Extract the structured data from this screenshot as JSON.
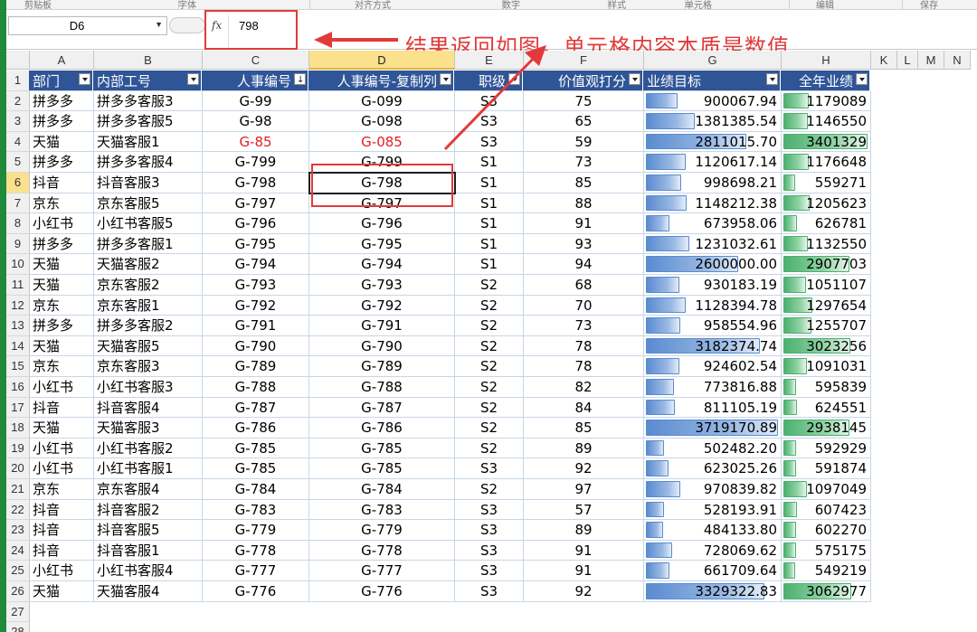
{
  "ribbon": {
    "groups": [
      "剪贴板",
      "字体",
      "对齐方式",
      "数字",
      "样式",
      "单元格",
      "编辑",
      "保存"
    ]
  },
  "formula_bar": {
    "name_box": "D6",
    "fx_label": "fx",
    "value": "798"
  },
  "annotation": {
    "text": "结果返回如图，单元格内容本质是数值"
  },
  "sheet": {
    "columns": [
      "A",
      "B",
      "C",
      "D",
      "E",
      "F",
      "G",
      "H",
      "K",
      "L",
      "M",
      "N"
    ],
    "active_column": "D",
    "active_row": "6",
    "headers": [
      "部门",
      "内部工号",
      "人事编号",
      "人事编号-复制列",
      "职级",
      "价值观打分",
      "业绩目标",
      "全年业绩"
    ],
    "rows": [
      {
        "n": "2",
        "dept": "拼多多",
        "staff": "拼多多客服3",
        "id": "G-99",
        "id_copy": "G-099",
        "level": "S3",
        "score": "75",
        "target": "900067.94",
        "target_frac": 0.24,
        "actual": "1179089",
        "actual_frac": 0.3
      },
      {
        "n": "3",
        "dept": "拼多多",
        "staff": "拼多多客服5",
        "id": "G-98",
        "id_copy": "G-098",
        "level": "S3",
        "score": "65",
        "target": "1381385.54",
        "target_frac": 0.37,
        "actual": "1146550",
        "actual_frac": 0.29
      },
      {
        "n": "4",
        "dept": "天猫",
        "staff": "天猫客服1",
        "id": "G-85",
        "id_copy": "G-085",
        "level": "S3",
        "score": "59",
        "target": "2811015.70",
        "target_frac": 0.76,
        "actual": "3401329",
        "actual_frac": 1.0,
        "red": true
      },
      {
        "n": "5",
        "dept": "拼多多",
        "staff": "拼多多客服4",
        "id": "G-799",
        "id_copy": "G-799",
        "level": "S1",
        "score": "73",
        "target": "1120617.14",
        "target_frac": 0.3,
        "actual": "1176648",
        "actual_frac": 0.3
      },
      {
        "n": "6",
        "dept": "抖音",
        "staff": "抖音客服3",
        "id": "G-798",
        "id_copy": "G-798",
        "level": "S1",
        "score": "85",
        "target": "998698.21",
        "target_frac": 0.27,
        "actual": "559271",
        "actual_frac": 0.14
      },
      {
        "n": "7",
        "dept": "京东",
        "staff": "京东客服5",
        "id": "G-797",
        "id_copy": "G-797",
        "level": "S1",
        "score": "88",
        "target": "1148212.38",
        "target_frac": 0.31,
        "actual": "1205623",
        "actual_frac": 0.31
      },
      {
        "n": "8",
        "dept": "小红书",
        "staff": "小红书客服5",
        "id": "G-796",
        "id_copy": "G-796",
        "level": "S1",
        "score": "91",
        "target": "673958.06",
        "target_frac": 0.18,
        "actual": "626781",
        "actual_frac": 0.16
      },
      {
        "n": "9",
        "dept": "拼多多",
        "staff": "拼多多客服1",
        "id": "G-795",
        "id_copy": "G-795",
        "level": "S1",
        "score": "93",
        "target": "1231032.61",
        "target_frac": 0.33,
        "actual": "1132550",
        "actual_frac": 0.29
      },
      {
        "n": "10",
        "dept": "天猫",
        "staff": "天猫客服2",
        "id": "G-794",
        "id_copy": "G-794",
        "level": "S1",
        "score": "94",
        "target": "2600000.00",
        "target_frac": 0.7,
        "actual": "2907703",
        "actual_frac": 0.78
      },
      {
        "n": "11",
        "dept": "天猫",
        "staff": "京东客服2",
        "id": "G-793",
        "id_copy": "G-793",
        "level": "S2",
        "score": "68",
        "target": "930183.19",
        "target_frac": 0.25,
        "actual": "1051107",
        "actual_frac": 0.27
      },
      {
        "n": "12",
        "dept": "京东",
        "staff": "京东客服1",
        "id": "G-792",
        "id_copy": "G-792",
        "level": "S2",
        "score": "70",
        "target": "1128394.78",
        "target_frac": 0.3,
        "actual": "1297654",
        "actual_frac": 0.34
      },
      {
        "n": "13",
        "dept": "拼多多",
        "staff": "拼多多客服2",
        "id": "G-791",
        "id_copy": "G-791",
        "level": "S2",
        "score": "73",
        "target": "958554.96",
        "target_frac": 0.26,
        "actual": "1255707",
        "actual_frac": 0.33
      },
      {
        "n": "14",
        "dept": "天猫",
        "staff": "天猫客服5",
        "id": "G-790",
        "id_copy": "G-790",
        "level": "S2",
        "score": "78",
        "target": "3182374.74",
        "target_frac": 0.86,
        "actual": "3023256",
        "actual_frac": 0.8
      },
      {
        "n": "15",
        "dept": "京东",
        "staff": "京东客服3",
        "id": "G-789",
        "id_copy": "G-789",
        "level": "S2",
        "score": "78",
        "target": "924602.54",
        "target_frac": 0.25,
        "actual": "1091031",
        "actual_frac": 0.28
      },
      {
        "n": "16",
        "dept": "小红书",
        "staff": "小红书客服3",
        "id": "G-788",
        "id_copy": "G-788",
        "level": "S2",
        "score": "82",
        "target": "773816.88",
        "target_frac": 0.21,
        "actual": "595839",
        "actual_frac": 0.15
      },
      {
        "n": "17",
        "dept": "抖音",
        "staff": "抖音客服4",
        "id": "G-787",
        "id_copy": "G-787",
        "level": "S2",
        "score": "84",
        "target": "811105.19",
        "target_frac": 0.22,
        "actual": "624551",
        "actual_frac": 0.16
      },
      {
        "n": "18",
        "dept": "天猫",
        "staff": "天猫客服3",
        "id": "G-786",
        "id_copy": "G-786",
        "level": "S2",
        "score": "85",
        "target": "3719170.89",
        "target_frac": 1.0,
        "actual": "2938145",
        "actual_frac": 0.78
      },
      {
        "n": "19",
        "dept": "小红书",
        "staff": "小红书客服2",
        "id": "G-785",
        "id_copy": "G-785",
        "level": "S2",
        "score": "89",
        "target": "502482.20",
        "target_frac": 0.14,
        "actual": "592929",
        "actual_frac": 0.15
      },
      {
        "n": "20",
        "dept": "小红书",
        "staff": "小红书客服1",
        "id": "G-785",
        "id_copy": "G-785",
        "level": "S3",
        "score": "92",
        "target": "623025.26",
        "target_frac": 0.17,
        "actual": "591874",
        "actual_frac": 0.15
      },
      {
        "n": "21",
        "dept": "京东",
        "staff": "京东客服4",
        "id": "G-784",
        "id_copy": "G-784",
        "level": "S2",
        "score": "97",
        "target": "970839.82",
        "target_frac": 0.26,
        "actual": "1097049",
        "actual_frac": 0.28
      },
      {
        "n": "22",
        "dept": "抖音",
        "staff": "抖音客服2",
        "id": "G-783",
        "id_copy": "G-783",
        "level": "S3",
        "score": "57",
        "target": "528193.91",
        "target_frac": 0.14,
        "actual": "607423",
        "actual_frac": 0.16
      },
      {
        "n": "23",
        "dept": "抖音",
        "staff": "抖音客服5",
        "id": "G-779",
        "id_copy": "G-779",
        "level": "S3",
        "score": "89",
        "target": "484133.80",
        "target_frac": 0.13,
        "actual": "602270",
        "actual_frac": 0.15
      },
      {
        "n": "24",
        "dept": "抖音",
        "staff": "抖音客服1",
        "id": "G-778",
        "id_copy": "G-778",
        "level": "S3",
        "score": "91",
        "target": "728069.62",
        "target_frac": 0.2,
        "actual": "575175",
        "actual_frac": 0.15
      },
      {
        "n": "25",
        "dept": "小红书",
        "staff": "小红书客服4",
        "id": "G-777",
        "id_copy": "G-777",
        "level": "S3",
        "score": "91",
        "target": "661709.64",
        "target_frac": 0.18,
        "actual": "549219",
        "actual_frac": 0.14
      },
      {
        "n": "26",
        "dept": "天猫",
        "staff": "天猫客服4",
        "id": "G-776",
        "id_copy": "G-776",
        "level": "S3",
        "score": "92",
        "target": "3329322.83",
        "target_frac": 0.9,
        "actual": "3062977",
        "actual_frac": 0.81
      }
    ],
    "extra_rows": [
      "27",
      "28"
    ]
  },
  "colors": {
    "header_bg": "#2f5597",
    "annotation_red": "#e23a3a",
    "highlight_red": "#e51c23",
    "databar_blue": "#5a8bd0",
    "databar_green": "#4cb070"
  }
}
